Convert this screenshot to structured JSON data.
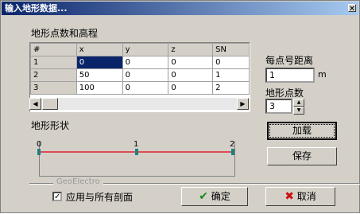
{
  "window": {
    "title": "输入地形数据...",
    "close_glyph": "×"
  },
  "points_section": {
    "label": "地形点数和高程"
  },
  "grid": {
    "headers": [
      "#",
      "x",
      "y",
      "z",
      "SN"
    ],
    "rows": [
      [
        "1",
        "0",
        "0",
        "0",
        "0"
      ],
      [
        "2",
        "50",
        "0",
        "0",
        "1"
      ],
      [
        "3",
        "100",
        "0",
        "0",
        "2"
      ]
    ],
    "selected_cell": "1,x"
  },
  "spacing": {
    "label": "每点号距离",
    "value": "1",
    "unit": "m"
  },
  "point_count": {
    "label": "地形点数",
    "value": "3"
  },
  "load_button": {
    "label": "加载"
  },
  "save_button": {
    "label": "保存"
  },
  "shape_section": {
    "label": "地形形状",
    "point_labels": [
      "0",
      "1",
      "2"
    ],
    "line_color": "#e0202c",
    "marker_color": "#1f8080"
  },
  "group": {
    "name": "GeoElectro"
  },
  "apply_all": {
    "label": "应用与所有剖面",
    "checked": true
  },
  "ok_button": {
    "label": "确定",
    "icon": "checkmark-icon",
    "icon_color": "#1a8a1a"
  },
  "cancel_button": {
    "label": "取消",
    "icon": "x-icon",
    "icon_color": "#cc1111"
  }
}
